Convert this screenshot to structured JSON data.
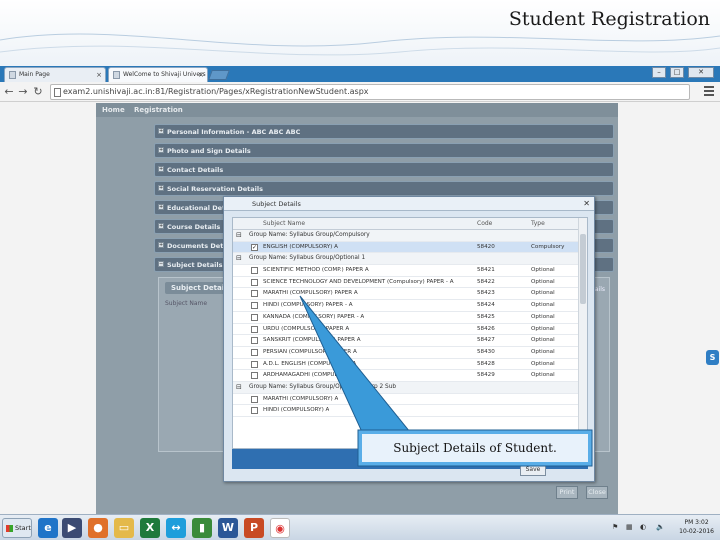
{
  "slide": {
    "title": "Student Registration"
  },
  "browser": {
    "tabs": [
      {
        "label": "Main Page"
      },
      {
        "label": "WelCome to Shivaji Univers"
      }
    ],
    "url": "exam2.unishivaji.ac.in:81/Registration/Pages/xRegistrationNewStudent.aspx"
  },
  "page": {
    "nav": [
      "Home",
      "Registration"
    ],
    "sections": [
      "Personal Information - ABC ABC ABC",
      "Photo and Sign Details",
      "Contact Details",
      "Social Reservation Details",
      "Educational Details",
      "Course Details",
      "Documents Details",
      "Subject Details"
    ],
    "inner_panel": {
      "header": "Subject Details",
      "sub_label": "Subject Name",
      "right_label": "ails"
    },
    "buttons": {
      "print": "Print",
      "close": "Close"
    }
  },
  "modal": {
    "title": "Subject Details",
    "columns": [
      "Subject Name",
      "Code",
      "Type"
    ],
    "rows": [
      {
        "kind": "group",
        "label": "Group Name: Syllabus Group/Compulsory"
      },
      {
        "kind": "item",
        "name": "ENGLISH (COMPULSORY) A",
        "code": "58420",
        "type": "Compulsory",
        "checked": true,
        "selected": true
      },
      {
        "kind": "group",
        "label": "Group Name: Syllabus Group/Optional 1"
      },
      {
        "kind": "item",
        "name": "SCIENTIFIC METHOD (COMP.) PAPER A",
        "code": "58421",
        "type": "Optional"
      },
      {
        "kind": "item",
        "name": "SCIENCE TECHNOLOGY AND DEVELOPMENT (Compulsory) PAPER - A",
        "code": "58422",
        "type": "Optional"
      },
      {
        "kind": "item",
        "name": "MARATHI (COMPULSORY) PAPER A",
        "code": "58423",
        "type": "Optional"
      },
      {
        "kind": "item",
        "name": "HINDI (COMPULSORY) PAPER - A",
        "code": "58424",
        "type": "Optional"
      },
      {
        "kind": "item",
        "name": "KANNADA (COMPULSORY) PAPER - A",
        "code": "58425",
        "type": "Optional"
      },
      {
        "kind": "item",
        "name": "URDU (COMPULSORY) PAPER A",
        "code": "58426",
        "type": "Optional"
      },
      {
        "kind": "item",
        "name": "SANSKRIT (COMPULSORY) PAPER A",
        "code": "58427",
        "type": "Optional"
      },
      {
        "kind": "item",
        "name": "PERSIAN (COMPULSORY) PAPER A",
        "code": "58430",
        "type": "Optional"
      },
      {
        "kind": "item",
        "name": "A.D.L. ENGLISH (COMPULSORY) A",
        "code": "58428",
        "type": "Optional"
      },
      {
        "kind": "item",
        "name": "ARDHAMAGADHI (COMPULSORY) A",
        "code": "58429",
        "type": "Optional"
      },
      {
        "kind": "group",
        "label": "Group Name: Syllabus Group/Optional 2/Grp 2 Sub"
      },
      {
        "kind": "item",
        "name": "MARATHI (COMPULSORY) A",
        "code": "",
        "type": ""
      },
      {
        "kind": "item",
        "name": "HINDI (COMPULSORY) A",
        "code": "",
        "type": ""
      }
    ],
    "save_label": "Save"
  },
  "callout": {
    "text": "Subject Details of Student."
  },
  "taskbar": {
    "start_label": "Start",
    "time": "PM 3:02",
    "date": "10-02-2016"
  }
}
